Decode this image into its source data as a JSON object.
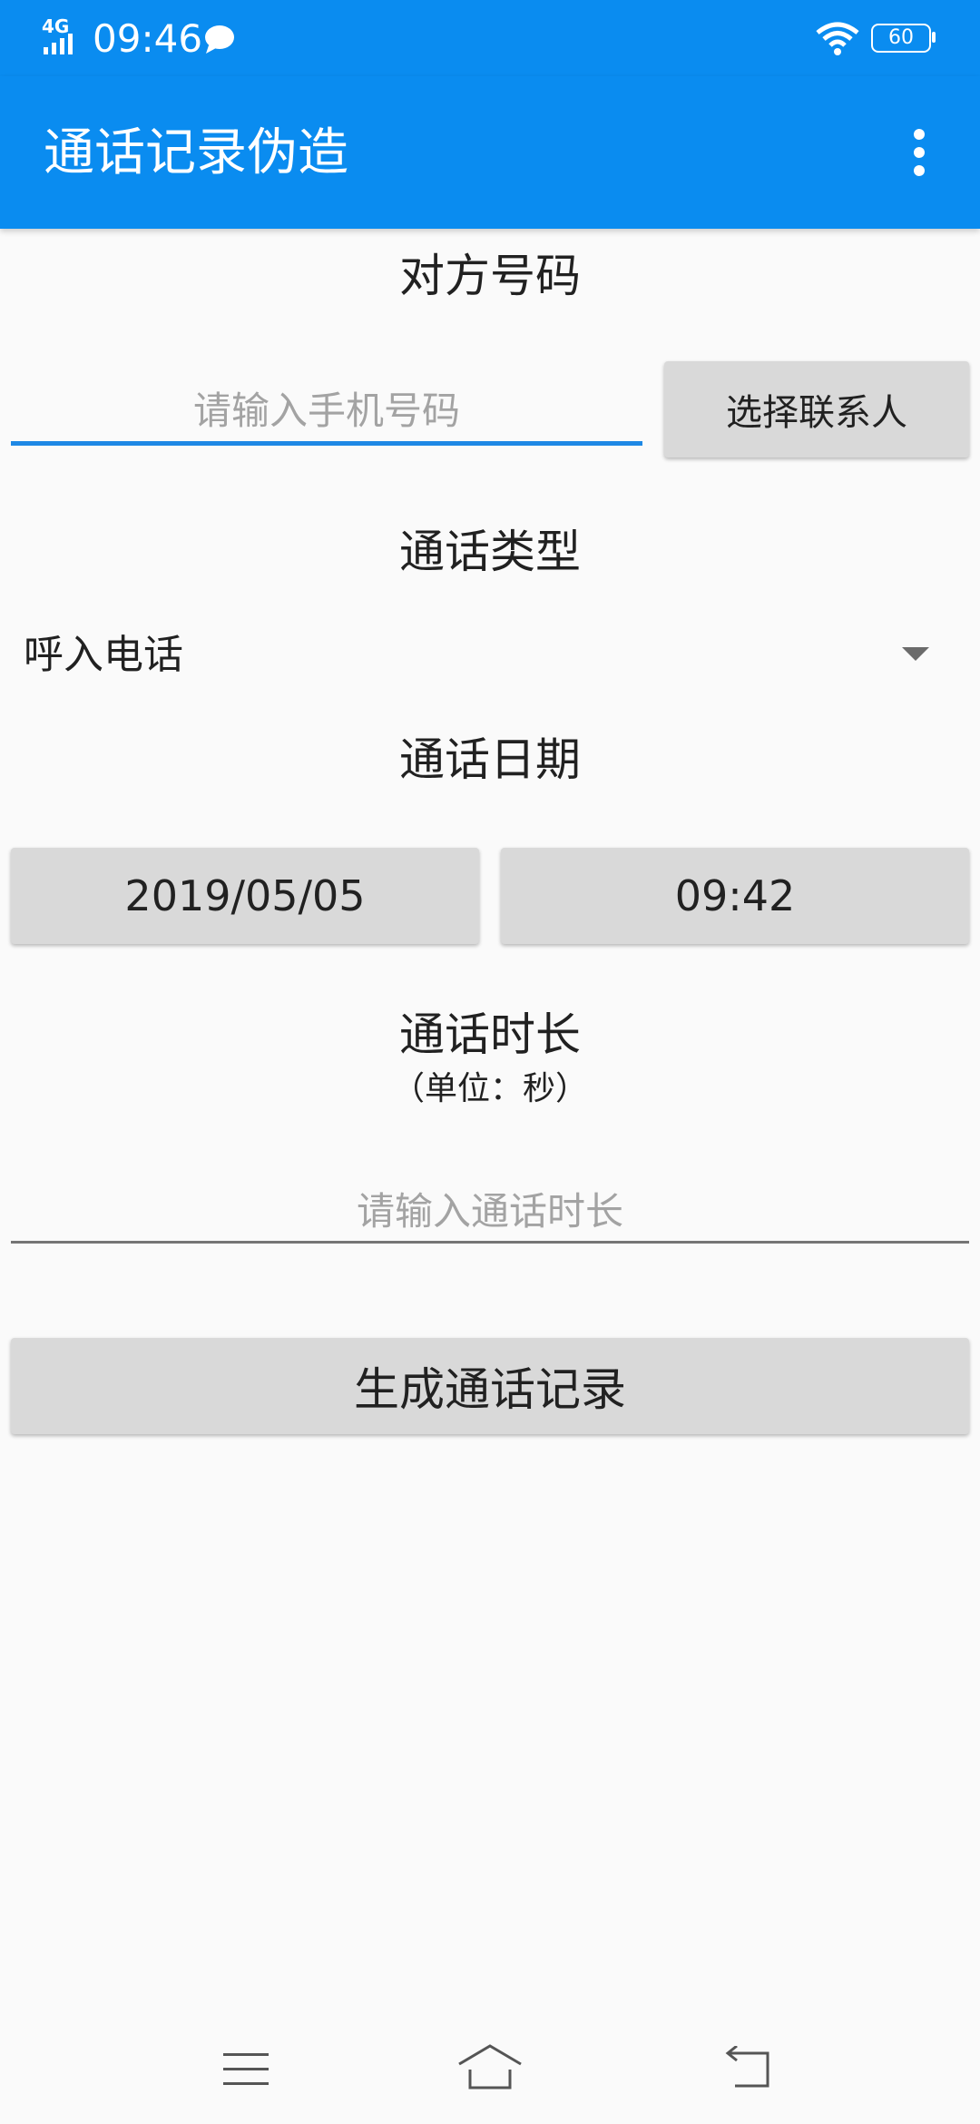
{
  "status_bar": {
    "network": "4G",
    "time": "09:46",
    "battery": "60"
  },
  "app_bar": {
    "title": "通话记录伪造"
  },
  "form": {
    "number_label": "对方号码",
    "number_placeholder": "请输入手机号码",
    "number_value": "",
    "contact_button": "选择联系人",
    "type_label": "通话类型",
    "type_selected": "呼入电话",
    "date_label": "通话日期",
    "date_value": "2019/05/05",
    "time_value": "09:42",
    "duration_label": "通话时长",
    "duration_unit": "（单位：秒）",
    "duration_placeholder": "请输入通话时长",
    "duration_value": "",
    "submit_button": "生成通话记录"
  },
  "colors": {
    "accent": "#0a8cf0",
    "input_focus": "#1e88e5",
    "button_bg": "#d9d9d9",
    "background": "#fafafa"
  },
  "icons": {
    "status": [
      "signal-icon",
      "chat-bubble-icon",
      "wifi-icon",
      "battery-icon"
    ],
    "app_bar": [
      "overflow-menu-icon"
    ],
    "nav": [
      "menu-lines-icon",
      "home-icon",
      "back-icon"
    ]
  }
}
